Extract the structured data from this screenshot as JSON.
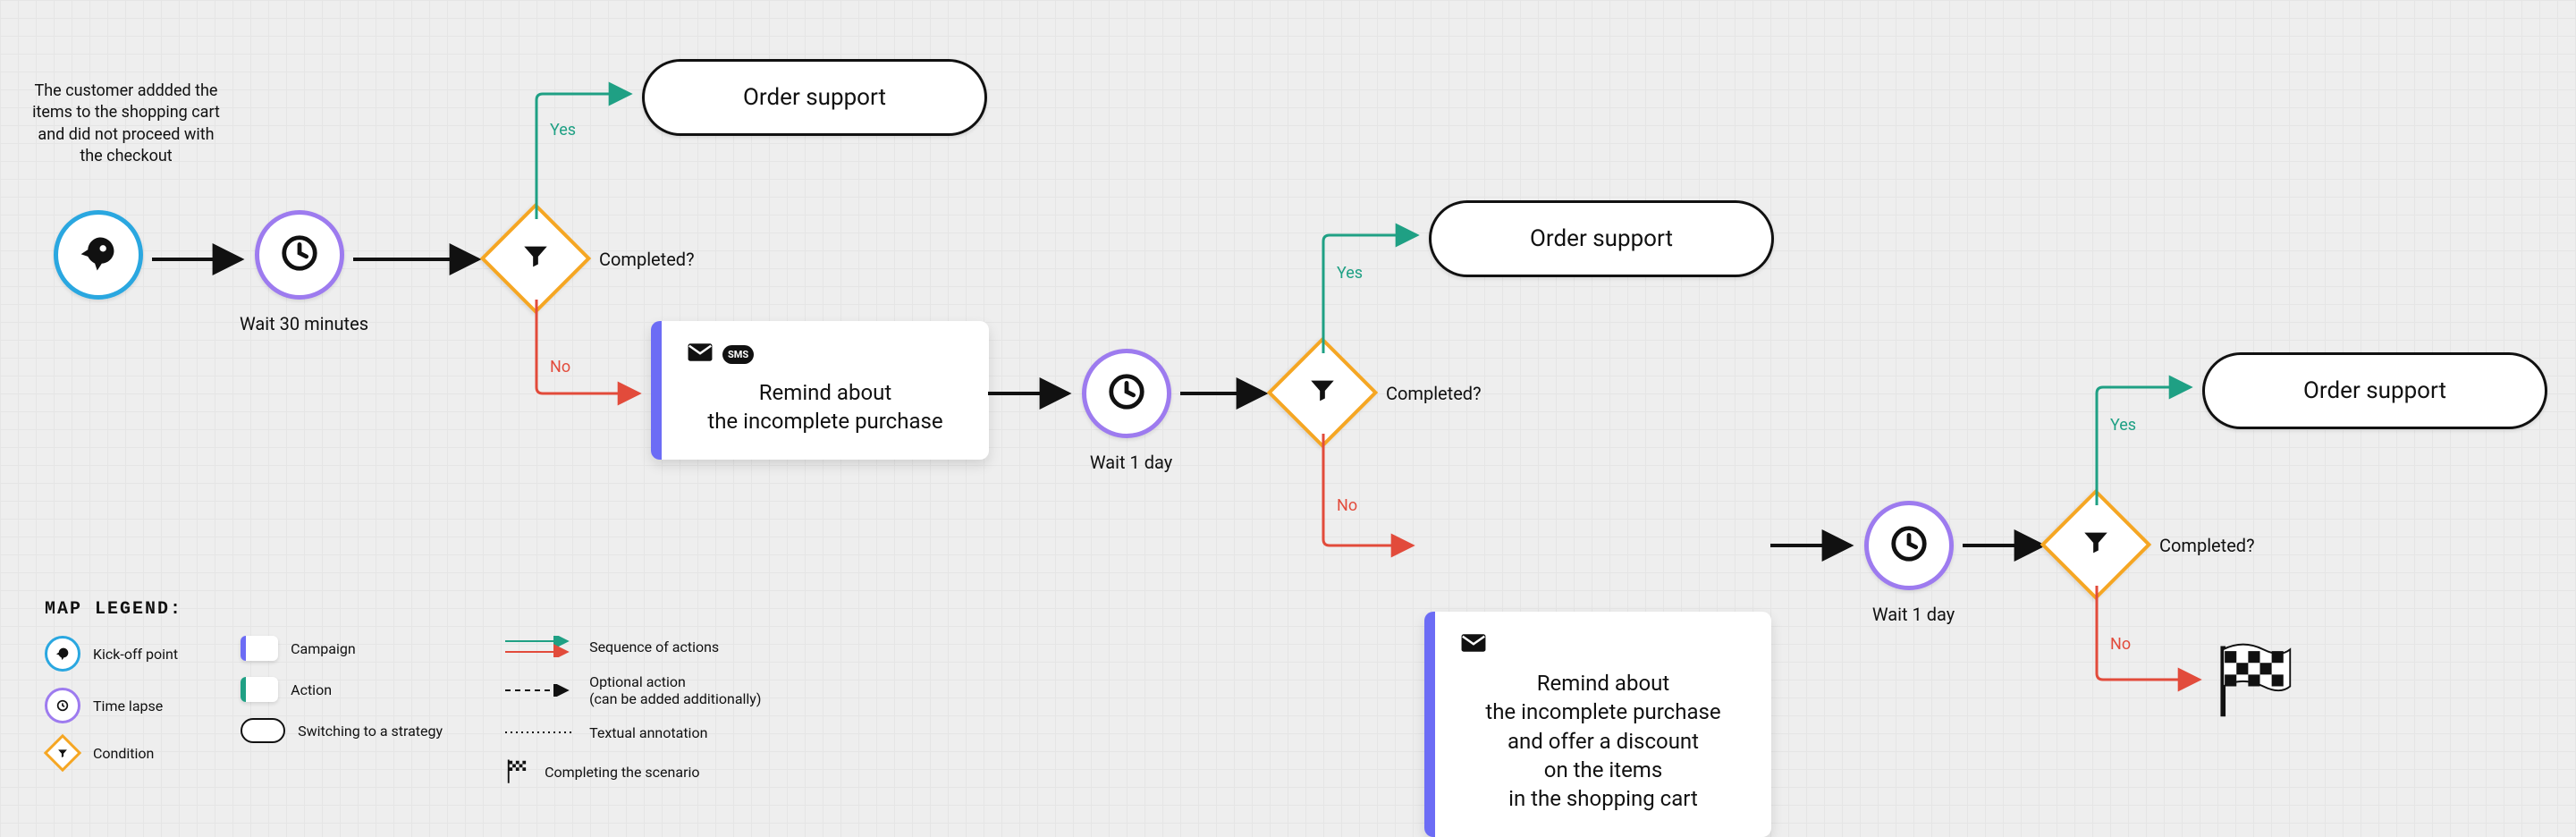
{
  "start_note": "The customer addded the items to the shopping cart and did not proceed with the checkout",
  "waits": {
    "w1": "Wait 30 minutes",
    "w2": "Wait 1 day",
    "w3": "Wait 1 day"
  },
  "condition_label": "Completed?",
  "branch": {
    "yes": "Yes",
    "no": "No"
  },
  "strategy": {
    "order_support": "Order support"
  },
  "cards": {
    "c1": "Remind about\nthe incomplete purchase",
    "c2": "Remind about\nthe incomplete purchase\nand offer a discount\non the items\nin the shopping cart"
  },
  "legend": {
    "title": "MAP LEGEND:",
    "items": {
      "kickoff": "Kick-off point",
      "timelapse": "Time lapse",
      "condition": "Condition",
      "campaign": "Campaign",
      "action": "Action",
      "strategy": "Switching to a strategy",
      "sequence": "Sequence of actions",
      "optional": "Optional action\n(can be added additionally)",
      "textual": "Textual annotation",
      "complete": "Completing the scenario"
    }
  }
}
